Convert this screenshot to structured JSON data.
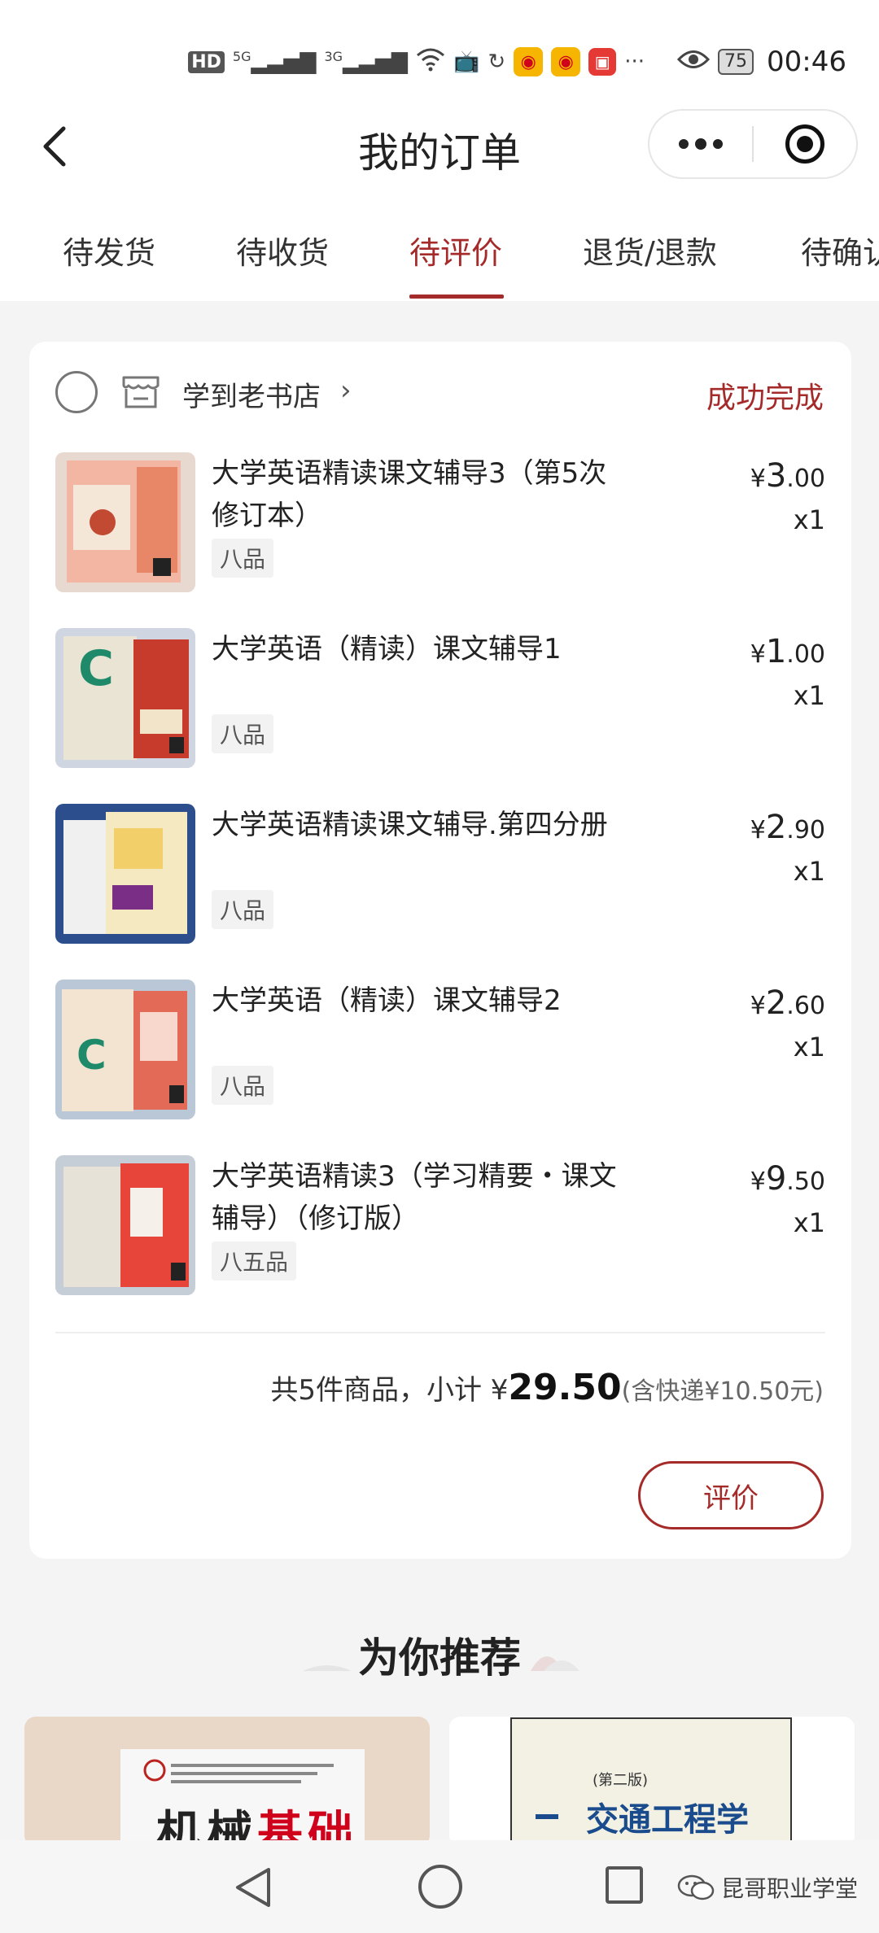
{
  "status_bar": {
    "hd": "HD",
    "sig1": "5G",
    "sig2": "3G",
    "battery": "75",
    "time": "00:46"
  },
  "header": {
    "title": "我的订单"
  },
  "tabs": [
    {
      "label": "待发货"
    },
    {
      "label": "待收货"
    },
    {
      "label": "待评价"
    },
    {
      "label": "退货/退款"
    },
    {
      "label": "待确认"
    }
  ],
  "order": {
    "shop_name": "学到老书店",
    "status": "成功完成",
    "items": [
      {
        "title": "大学英语精读课文辅导3（第5次修订本）",
        "grade": "八品",
        "price_int": "3",
        "price_dec": ".00",
        "qty": "x1"
      },
      {
        "title": "大学英语（精读）课文辅导1",
        "grade": "八品",
        "price_int": "1",
        "price_dec": ".00",
        "qty": "x1"
      },
      {
        "title": "大学英语精读课文辅导.第四分册",
        "grade": "八品",
        "price_int": "2",
        "price_dec": ".90",
        "qty": "x1"
      },
      {
        "title": "大学英语（精读）课文辅导2",
        "grade": "八品",
        "price_int": "2",
        "price_dec": ".60",
        "qty": "x1"
      },
      {
        "title": "大学英语精读3（学习精要・课文辅导）（修订版）",
        "grade": "八五品",
        "price_int": "9",
        "price_dec": ".50",
        "qty": "x1"
      }
    ],
    "currency": "¥",
    "summary_prefix": "共5件商品，小计",
    "total": "29.50",
    "shipping_note": "(含快递¥10.50元)",
    "review_button": "评价"
  },
  "recommend": {
    "title": "为你推荐",
    "left_book_title_a": "机械",
    "left_book_title_b": "基础",
    "right_book_edition": "(第二版)",
    "right_book_title": "交通工程学"
  },
  "watermark": {
    "text": "昆哥职业学堂"
  },
  "colors": {
    "accent": "#a52a2a",
    "background": "#f4f4f4"
  }
}
